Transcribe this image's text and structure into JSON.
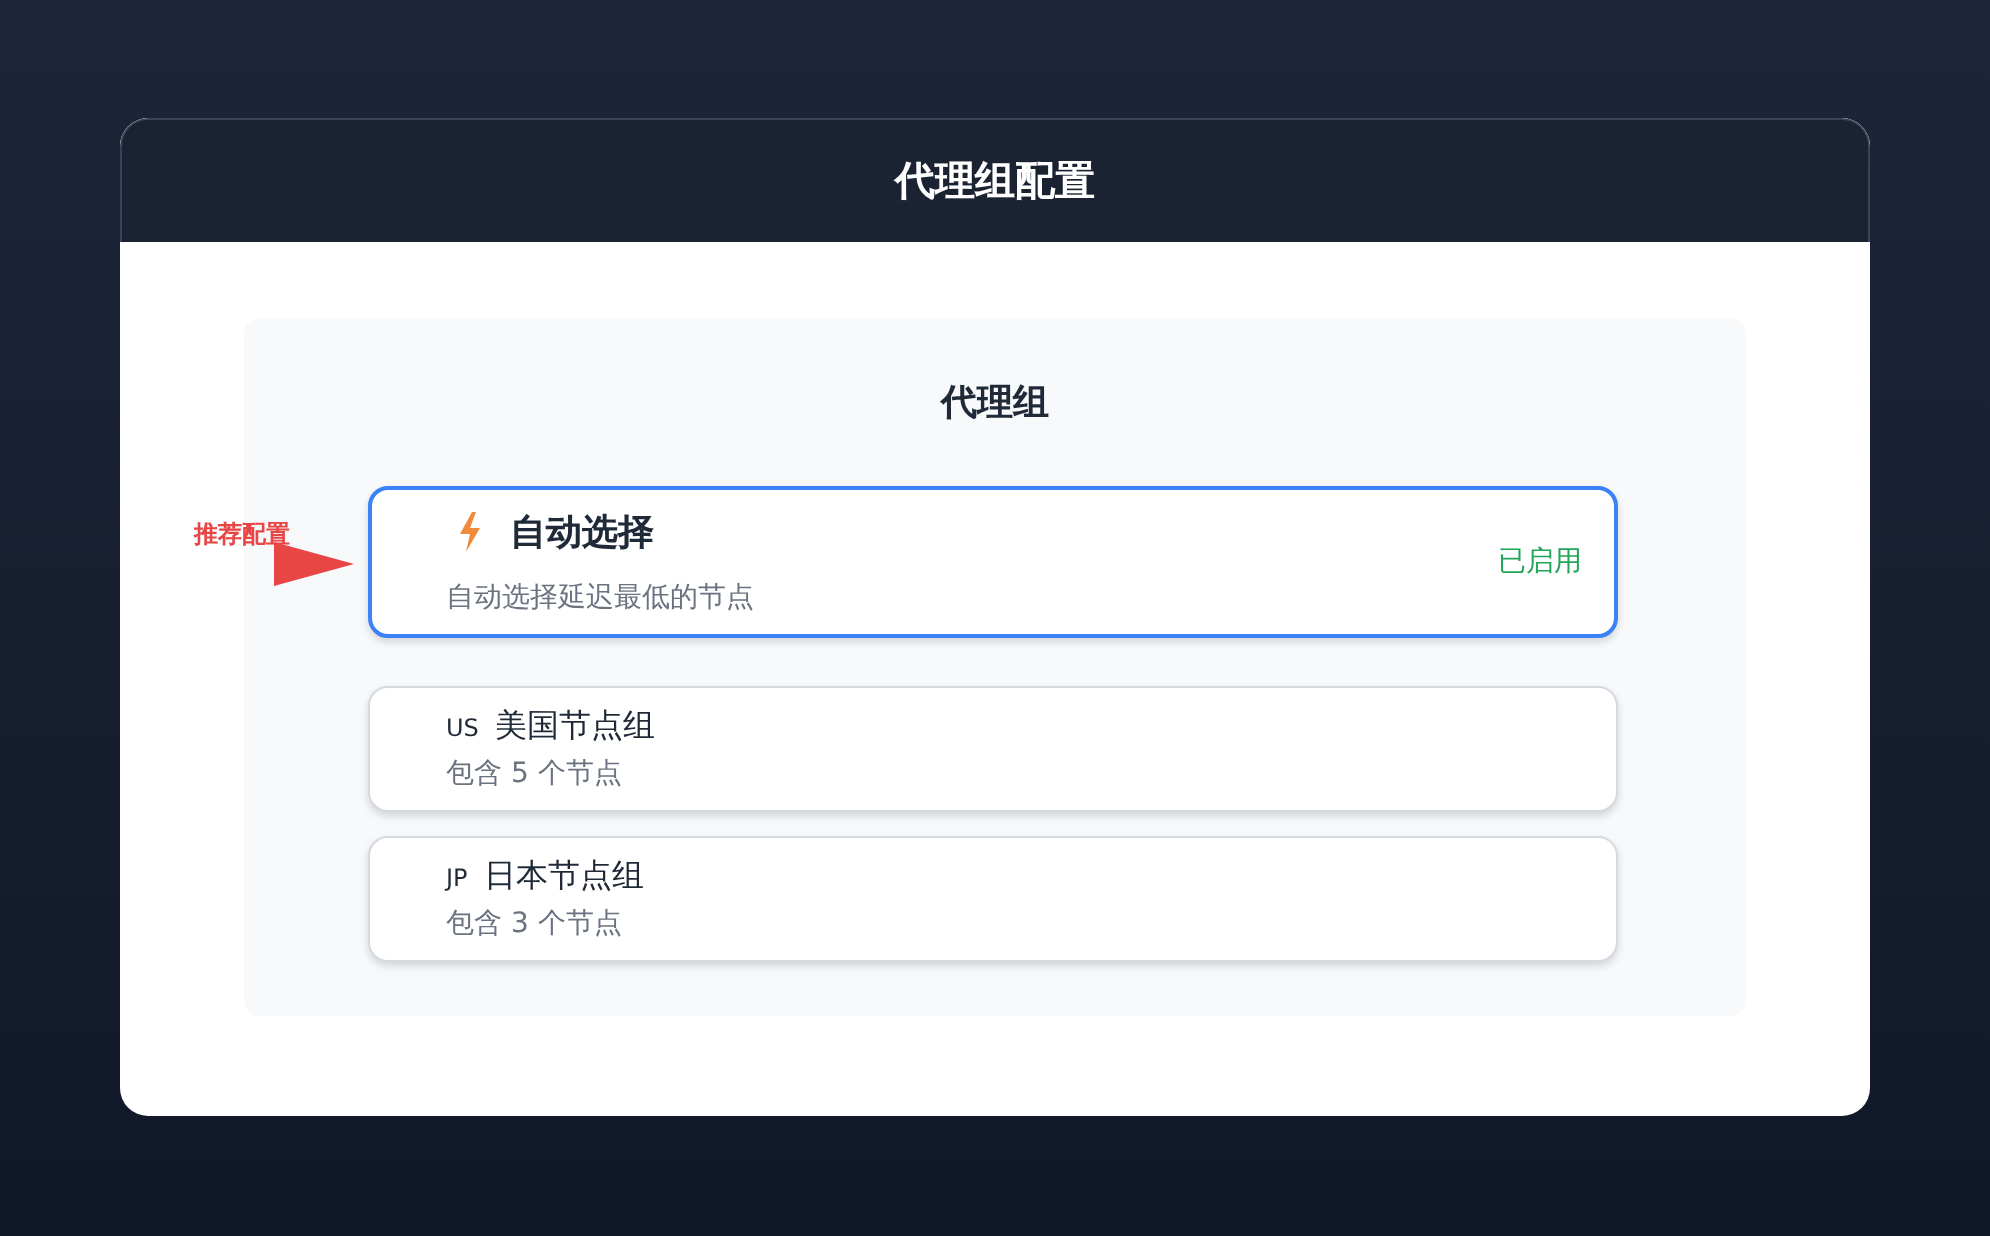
{
  "window": {
    "title": "代理组配置"
  },
  "panel": {
    "title": "代理组"
  },
  "annotation": {
    "label": "推荐配置"
  },
  "groups": [
    {
      "kind": "auto",
      "name": "自动选择",
      "description": "自动选择延迟最低的节点",
      "status": "已启用",
      "selected": true
    },
    {
      "kind": "region",
      "code": "US",
      "name": "美国节点组",
      "description": "包含 5 个节点",
      "selected": false
    },
    {
      "kind": "region",
      "code": "JP",
      "name": "日本节点组",
      "description": "包含 3 个节点",
      "selected": false
    }
  ]
}
